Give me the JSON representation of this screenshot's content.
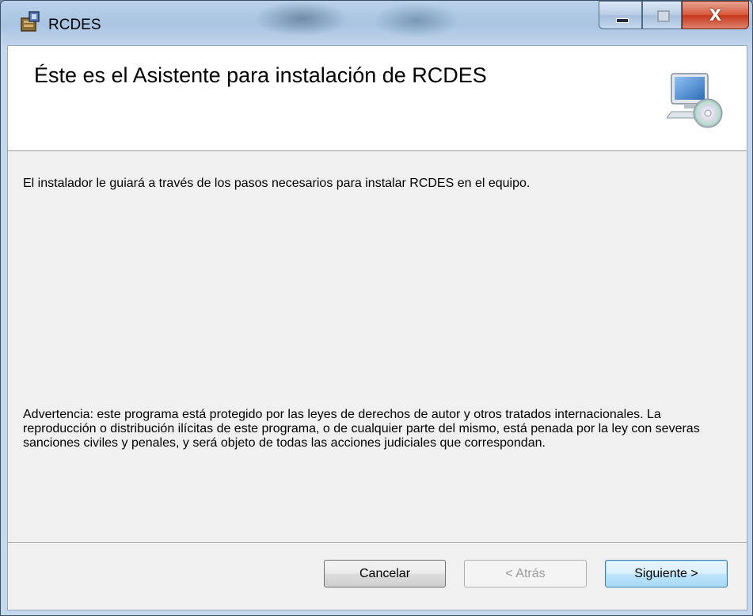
{
  "window": {
    "title": "RCDES",
    "controls": {
      "minimize": "minimize",
      "maximize": "maximize",
      "close": "X"
    }
  },
  "banner": {
    "title": "Éste es el Asistente para instalación de RCDES"
  },
  "body": {
    "intro": "El instalador le guiará a través de los pasos necesarios para instalar RCDES en el equipo.",
    "warning": "Advertencia: este programa está protegido por las leyes de derechos de autor y otros tratados internacionales. La reproducción o distribución ilícitas de este programa, o de cualquier parte del mismo, está penada por la ley con severas sanciones civiles y penales, y será objeto de todas las acciones judiciales que correspondan."
  },
  "buttons": {
    "cancel": "Cancelar",
    "back": "< Atrás",
    "next": "Siguiente >"
  },
  "icons": {
    "app": "installer-icon",
    "banner": "computer-cd-icon"
  },
  "colors": {
    "titlebar": "#b9d1ea",
    "close_button": "#c4371b",
    "dialog_background": "#f0f0f0",
    "banner_background": "#ffffff",
    "default_button_border": "#3c7fb1"
  }
}
